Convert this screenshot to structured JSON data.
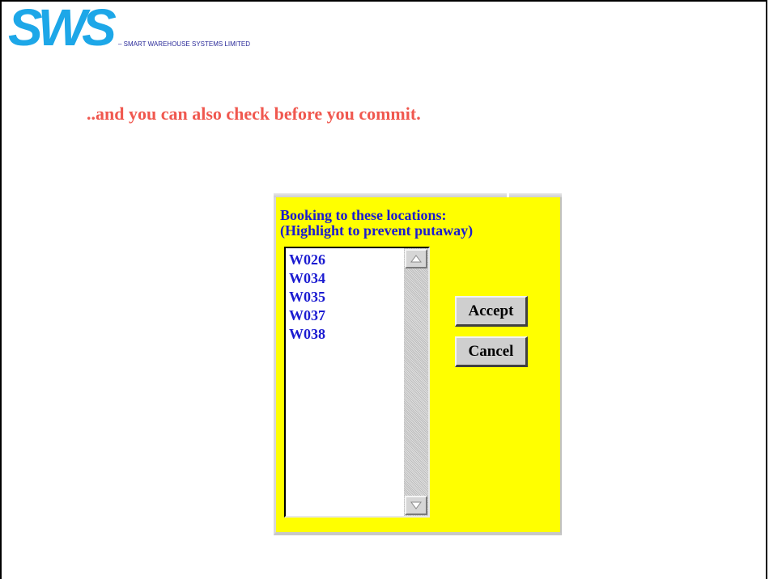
{
  "logo": {
    "text": "SWS",
    "tagline": "– SMART WAREHOUSE SYSTEMS LIMITED"
  },
  "headline": "..and you can also check before you commit.",
  "dialog": {
    "title_line1": "Booking to these locations:",
    "title_line2": "(Highlight to prevent putaway)",
    "locations": [
      "W026",
      "W034",
      "W035",
      "W037",
      "W038"
    ],
    "accept_label": "Accept",
    "cancel_label": "Cancel"
  },
  "colors": {
    "logo_blue": "#1da7e8",
    "headline": "#f0584f",
    "dialog_bg": "#ffff00",
    "dialog_text": "#1b1bd1"
  },
  "icons": {
    "scroll_up": "triangle-up-icon",
    "scroll_down": "triangle-down-icon"
  }
}
